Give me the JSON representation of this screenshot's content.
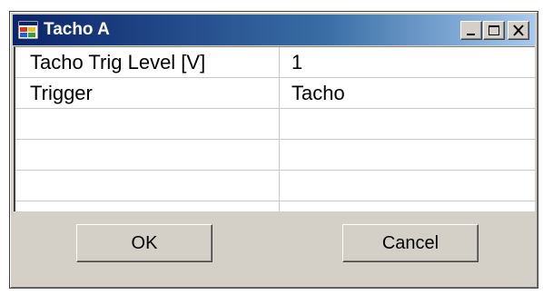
{
  "window": {
    "title": "Tacho A",
    "icon": "app-window-icon",
    "controls": [
      "minimize-icon",
      "maximize-icon",
      "close-icon"
    ]
  },
  "grid": {
    "rows": [
      {
        "name": "Tacho Trig Level [V]",
        "value": "1"
      },
      {
        "name": "Trigger",
        "value": "Tacho"
      },
      {
        "name": "",
        "value": ""
      },
      {
        "name": "",
        "value": ""
      },
      {
        "name": "",
        "value": ""
      }
    ]
  },
  "buttons": {
    "ok_label": "OK",
    "cancel_label": "Cancel"
  }
}
